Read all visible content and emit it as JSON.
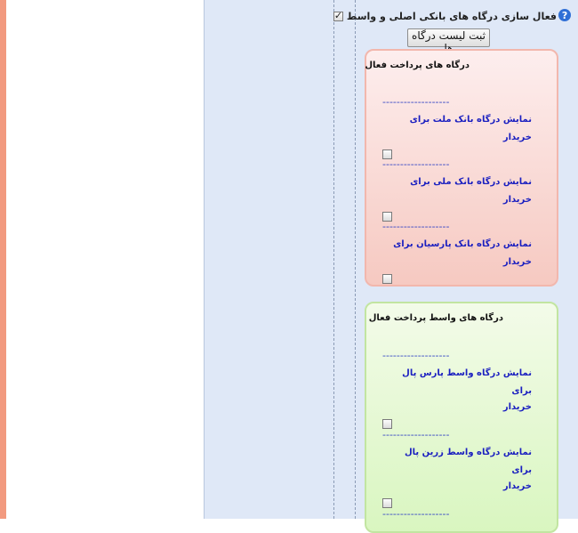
{
  "settings": {
    "enable_label": "فعال سازی درگاه های بانکی اصلی و واسط",
    "enable_checked": true,
    "submit_label": "ثبت لیست درگاه ها"
  },
  "bank_gateways": {
    "title": "درگاه های پرداخت فعال",
    "separator": "-------------------",
    "items": [
      {
        "label": "نمایش درگاه بانک ملت برای خریدار"
      },
      {
        "label": "نمایش درگاه بانک ملی برای خریدار"
      },
      {
        "label": "نمایش درگاه بانک پارسیان برای خریدار"
      }
    ]
  },
  "agent_gateways": {
    "title": "درگاه های واسط پرداخت فعال",
    "separator": "-------------------",
    "items": [
      {
        "label_line1": "نمایش درگاه واسط پارس پال برای",
        "label_line2": "خریدار"
      },
      {
        "label_line1": "نمایش درگاه واسط زرین پال برای",
        "label_line2": "خریدار"
      }
    ]
  },
  "icons": {
    "help": "question-circle-icon",
    "help_glyph": "?"
  }
}
